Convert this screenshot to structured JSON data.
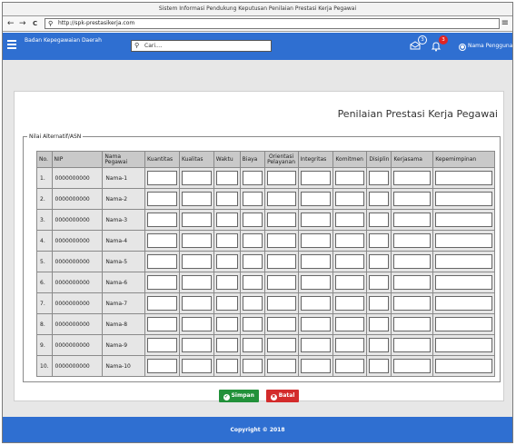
{
  "browser": {
    "window_title": "Sistem Informasi Pendukung Keputusan Penilaian Prestasi Kerja Pegawai",
    "url": "http://spk-prestasikerja.com",
    "back_glyph": "←",
    "forward_glyph": "→",
    "reload_glyph": "C",
    "search_glyph": "⚲",
    "menu_glyph": "≡"
  },
  "header": {
    "brand": "Badan Kepegawaian Daerah",
    "search_placeholder": "Cari....",
    "messages_count": "3",
    "notifications_count": "3",
    "user_name": "Nama Pengguna",
    "colors": {
      "bar": "#2f6fd1",
      "badge_red": "#e02424"
    }
  },
  "main": {
    "page_title": "Penilaian Prestasi Kerja Pegawai",
    "fieldset_legend": "Nilai Alternatif/ASN",
    "columns": {
      "no": "No.",
      "nip": "NIP",
      "nama": "Nama Pegawai",
      "kuantitas": "Kuantitas",
      "kualitas": "Kualitas",
      "waktu": "Waktu",
      "biaya": "Biaya",
      "orientasi": "Orientasi Pelayanan",
      "integritas": "Integritas",
      "komitmen": "Komitmen",
      "disiplin": "Disiplin",
      "kerjasama": "Kerjasama",
      "kepemimpinan": "Kepemimpinan"
    },
    "rows": [
      {
        "no": "1.",
        "nip": "0000000000",
        "nama": "Nama-1"
      },
      {
        "no": "2.",
        "nip": "0000000000",
        "nama": "Nama-2"
      },
      {
        "no": "3.",
        "nip": "0000000000",
        "nama": "Nama-3"
      },
      {
        "no": "4.",
        "nip": "0000000000",
        "nama": "Nama-4"
      },
      {
        "no": "5.",
        "nip": "0000000000",
        "nama": "Nama-5"
      },
      {
        "no": "6.",
        "nip": "0000000000",
        "nama": "Nama-6"
      },
      {
        "no": "7.",
        "nip": "0000000000",
        "nama": "Nama-7"
      },
      {
        "no": "8.",
        "nip": "0000000000",
        "nama": "Nama-8"
      },
      {
        "no": "9.",
        "nip": "0000000000",
        "nama": "Nama-9"
      },
      {
        "no": "10.",
        "nip": "0000000000",
        "nama": "Nama-10"
      }
    ],
    "save_label": "Simpan",
    "cancel_label": "Batal",
    "colors": {
      "save": "#22913a",
      "cancel": "#d32b2b"
    }
  },
  "footer": {
    "text": "Copyright © 2018"
  }
}
